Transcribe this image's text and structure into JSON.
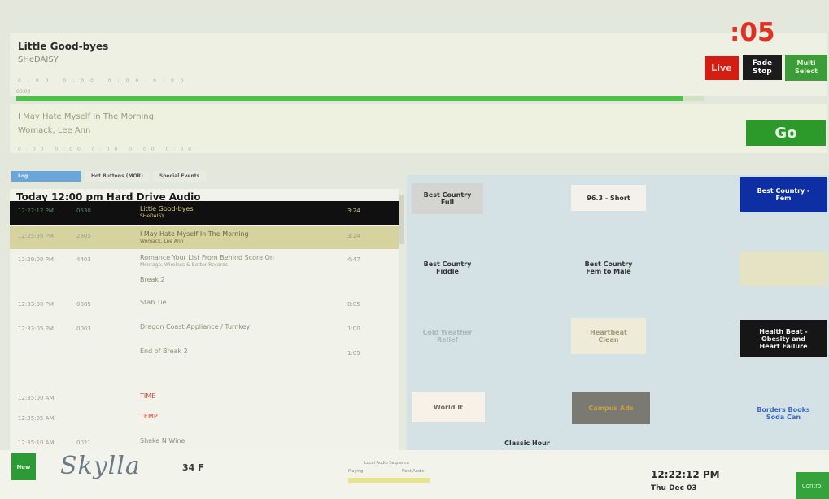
{
  "now_playing": {
    "title": "Little Good-byes",
    "artist": "SHeDAISY",
    "meta": "0:00   0:00   0:00   0:00"
  },
  "countdown": ":05",
  "controls": {
    "live_label": "Live",
    "fade_stop_label": "Fade\nStop",
    "multi_label": "Multi\nSelect",
    "go_label": "Go"
  },
  "progress": {
    "label": "00:05",
    "fraction": 0.97,
    "color": "#4fc14a"
  },
  "next_up": {
    "title": "I May Hate Myself In The Morning",
    "artist": "Womack, Lee Ann",
    "meta": "0:00   0:00   0:00   0:00   0:00"
  },
  "tabs": [
    {
      "label": "Log",
      "active": true
    },
    {
      "label": "Hot Buttons (MOR)",
      "active": false
    },
    {
      "label": "Special Events",
      "active": false
    }
  ],
  "log": {
    "header": "Today 12:00 pm Hard Drive Audio",
    "rows": [
      {
        "time": "12:22:12 PM",
        "cart": "0530",
        "title": "Little Good-byes",
        "sub": "SHeDAISY",
        "len": "3:24",
        "state": "playing"
      },
      {
        "time": "12:25:36 PM",
        "cart": "2805",
        "title": "I May Hate Myself In The Morning",
        "sub": "Womack, Lee Ann",
        "len": "3:24",
        "state": "next"
      },
      {
        "time": "12:29:00 PM",
        "cart": "4403",
        "title": "Romance Your List From Behind Score On",
        "sub": "Montage, Wireless & Better Records",
        "len": "4:47",
        "state": ""
      },
      {
        "time": "",
        "cart": "",
        "title": "Break 2",
        "sub": "",
        "len": "",
        "state": ""
      },
      {
        "time": "12:33:00 PM",
        "cart": "0085",
        "title": "Stab Tie",
        "sub": "",
        "len": "0:05",
        "state": ""
      },
      {
        "time": "12:33:05 PM",
        "cart": "0003",
        "title": "Dragon Coast Appliance / Turnkey",
        "sub": "",
        "len": "1:00",
        "state": ""
      },
      {
        "time": "",
        "cart": "",
        "title": "End of Break 2",
        "sub": "",
        "len": "1:05",
        "state": ""
      },
      {
        "time": "12:35:00 AM",
        "cart": "",
        "title": "TIME",
        "sub": "",
        "len": "",
        "state": "red"
      },
      {
        "time": "12:35:05 AM",
        "cart": "",
        "title": "TEMP",
        "sub": "",
        "len": "",
        "state": "red"
      },
      {
        "time": "12:35:10 AM",
        "cart": "0021",
        "title": "Shake N Wine",
        "sub": "",
        "len": "",
        "state": ""
      }
    ]
  },
  "hot_buttons": [
    {
      "label": "Best Country\nFull",
      "bg": "#d4d5d2",
      "fg": "#333333"
    },
    {
      "label": "96.3 - Short",
      "bg": "#f3f1ea",
      "fg": "#333333"
    },
    {
      "label": "Best Country -\nFem",
      "bg": "#0d2fa3",
      "fg": "#ffffff"
    },
    {
      "label": "Best Country\nFiddle",
      "bg": "#d4e2e5",
      "fg": "#333333"
    },
    {
      "label": "Best Country\nFem to Male",
      "bg": "#d4e2e5",
      "fg": "#333333"
    },
    {
      "label": "",
      "bg": "#e6e3c4",
      "fg": "#c9c07a"
    },
    {
      "label": "Cold Weather\nRelief",
      "bg": "#d4e2e5",
      "fg": "#a8b8bc"
    },
    {
      "label": "Heartbeat\nClean",
      "bg": "#eeebd8",
      "fg": "#a09a7e"
    },
    {
      "label": "Health Beat -\nObesity and\nHeart Failure",
      "bg": "#161616",
      "fg": "#f0f0f0"
    },
    {
      "label": "World It",
      "bg": "#f7f1e8",
      "fg": "#7a6a5a"
    },
    {
      "label": "Campus Ads",
      "bg": "#7a7a72",
      "fg": "#c8a040"
    },
    {
      "label": "Borders Books\nSoda Can",
      "bg": "#d4e2e5",
      "fg": "#3a68c7"
    },
    {
      "label": "Classic Hour",
      "bg": "#d4e2e5",
      "fg": "#333333"
    }
  ],
  "bottom": {
    "new_label": "New",
    "logo": "Skylla",
    "temperature": "34 F",
    "mini_line1": "Local Audio Sequence",
    "mini_line2": "Playing",
    "mini_line3": "Next Audio",
    "clock": "12:22:12 PM",
    "date": "Thu Dec 03",
    "corner_label": "Control"
  }
}
